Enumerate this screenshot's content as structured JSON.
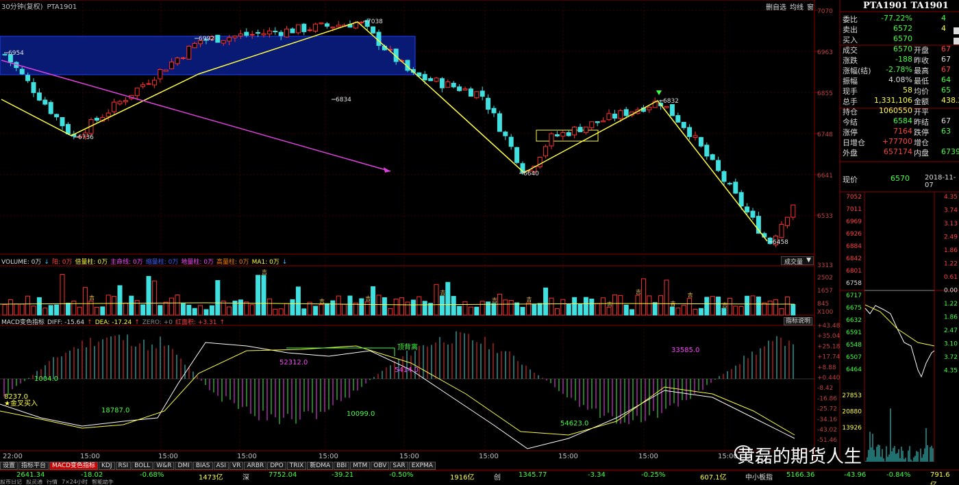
{
  "topbar": {
    "period": "30分钟(复权)",
    "symbol": "PTA1901"
  },
  "topright": {
    "btn1": "删自选",
    "btn2": "均线",
    "btn3": "窗"
  },
  "price_axis": [
    "7070",
    "6963",
    "6855",
    "6748",
    "6641",
    "6533"
  ],
  "annotations": {
    "p6954": "6954",
    "p6992": "6992",
    "p7038": "7038",
    "p6736": "6736",
    "p6834": "6834",
    "p6640": "6640",
    "p6832": "6832",
    "p6458": "6458"
  },
  "volume": {
    "legend": [
      {
        "t": "VOLUME: 0万",
        "c": "#ddd"
      },
      {
        "t": "↓",
        "c": "#30c0ff"
      },
      {
        "t": "阳: 0万",
        "c": "#ff4040"
      },
      {
        "t": "倍量柱: 0万",
        "c": "#ffff40"
      },
      {
        "t": "主命线: 0万",
        "c": "#ff40ff"
      },
      {
        "t": "缩量柱: 0万",
        "c": "#4060ff"
      },
      {
        "t": "地量柱: 0万",
        "c": "#ff40ff"
      },
      {
        "t": "高量柱: 0万",
        "c": "#ff8000"
      },
      {
        "t": "MA1: 0万",
        "c": "#ffff40"
      },
      {
        "t": "↓",
        "c": "#30c0ff"
      }
    ],
    "dropdown": "成交量",
    "axis": [
      "3313",
      "2502",
      "1657",
      "845",
      "X100"
    ],
    "tag": "吉"
  },
  "macd": {
    "legend": [
      {
        "t": "MACD变色指标",
        "c": "#ddd"
      },
      {
        "t": "DIFF: -15.64",
        "c": "#ddd"
      },
      {
        "t": "↑",
        "c": "#ff4040"
      },
      {
        "t": "DEA: -17.24",
        "c": "#ffff40"
      },
      {
        "t": "↑",
        "c": "#ff4040"
      },
      {
        "t": "ZERO: +0",
        "c": "#888"
      },
      {
        "t": "红面积: +3.31",
        "c": "#ff4040"
      },
      {
        "t": "↑",
        "c": "#ff4040"
      }
    ],
    "btn": "指标说明",
    "axis": [
      "+43.48",
      "+35.04",
      "+25.18",
      "+17.74",
      "+8.88",
      "+0.440",
      "-8.42",
      "-16.86",
      "-25.72",
      "-34.16",
      "-43.02",
      "-51.46"
    ],
    "labels": {
      "a1004": "1004.0",
      "a8237": "8237.0",
      "a18787": "18787.0",
      "a52312": "52312.0",
      "a5414": "5414.0",
      "a10099": "10099.0",
      "a54623": "54623.0",
      "a33585": "33585.0"
    },
    "top_div": "顶背离",
    "golden": "★金叉买入"
  },
  "x_axis": [
    "22:00",
    "15:00",
    "15:00",
    "15:00",
    "15:00",
    "15:00",
    "15:00",
    "15:00",
    "15:00",
    "15:00"
  ],
  "tabs": [
    "设置",
    "指标平台",
    "MACD变色指标",
    "KDJ",
    "RSI",
    "BOLL",
    "W&R",
    "DMI",
    "BIAS",
    "ASI",
    "VR",
    "ARBR",
    "DPO",
    "TRIX",
    "新DMA",
    "BBI",
    "MTM",
    "OBV",
    "SAR",
    "EXPMA"
  ],
  "index_bar": {
    "v1": "2641.34",
    "v2": "-18.02",
    "v3": "-0.68%",
    "v4": "1473亿",
    "sz": "深",
    "v5": "7752.04",
    "v6": "-39.21",
    "v7": "-0.50%",
    "v8": "1916亿",
    "cy": "创",
    "v9": "1345.77",
    "v10": "-3.34",
    "v11": "-0.25%",
    "v12": "607.1亿",
    "zx": "中小板指",
    "v13": "5166.36",
    "v14": "-43.96",
    "v15": "-0.84%",
    "v16": "791.6亿"
  },
  "bottombar": [
    "股市日记",
    "股灵通",
    "行情",
    "7×24小时",
    "智能助手"
  ],
  "quote": {
    "title": "PTA1901 TA1901",
    "rows": [
      {
        "l": "委比",
        "v": "-77.22%",
        "vc": "#40ff40",
        "r": "",
        "rv": "4",
        "rc": "#40ff40"
      },
      {
        "l": "卖出",
        "v": "6572",
        "vc": "#40ff40",
        "r": "",
        "rv": "4",
        "rc": "#ffff40"
      },
      {
        "l": "买入",
        "v": "6570",
        "vc": "#40ff40",
        "r": "",
        "rv": "",
        "rc": "#ffff40"
      },
      {
        "l": "成交",
        "v": "6570",
        "vc": "#40ff40",
        "r": "开盘",
        "rv": "67",
        "rc": "#ff4040"
      },
      {
        "l": "涨跌",
        "v": "-188",
        "vc": "#40ff40",
        "r": "昨收",
        "rv": "67",
        "rc": "#ddd"
      },
      {
        "l": "涨幅(结)",
        "v": "-2.78%",
        "vc": "#40ff40",
        "r": "最高",
        "rv": "67",
        "rc": "#ff4040"
      },
      {
        "l": "振幅",
        "v": "4.08%",
        "vc": "#ddd",
        "r": "最低",
        "rv": "64",
        "rc": "#40ff40"
      },
      {
        "l": "现手",
        "v": "58",
        "vc": "#ffff40",
        "r": "均价",
        "rv": "65",
        "rc": "#40ff40"
      },
      {
        "l": "总手",
        "v": "1,331,106",
        "vc": "#ffff40",
        "r": "金额",
        "rv": "438.2",
        "rc": "#ffff40"
      },
      {
        "l": "持仓",
        "v": "1060550",
        "vc": "#ffff40",
        "r": "开平",
        "rv": "",
        "rc": "#ddd"
      },
      {
        "l": "今结",
        "v": "6584",
        "vc": "#40ff40",
        "r": "昨结",
        "rv": "67",
        "rc": "#ddd"
      },
      {
        "l": "涨停",
        "v": "7164",
        "vc": "#ff4040",
        "r": "跌停",
        "rv": "63",
        "rc": "#40ff40"
      },
      {
        "l": "日增仓",
        "v": "+77700",
        "vc": "#ff4040",
        "r": "增仓",
        "rv": "",
        "rc": "#ddd"
      },
      {
        "l": "外盘",
        "v": "657174",
        "vc": "#ff4040",
        "r": "内盘",
        "rv": "6739",
        "rc": "#40ff40"
      }
    ],
    "now_label": "现价",
    "now": "6570",
    "date": "2018-11-07"
  },
  "mini": {
    "left_axis": [
      "7052",
      "7011",
      "6969",
      "6926",
      "6884",
      "6842",
      "6801",
      "6758",
      "6717",
      "6675",
      "6632",
      "6591",
      "6548",
      "6507",
      "6464",
      "27853",
      "20880",
      "13926"
    ],
    "right_axis": [
      "4.35",
      "3.74",
      "3.13",
      "2.49",
      "1.86",
      "1.22",
      "0.61",
      "0.00",
      "1.22",
      "1.86",
      "2.47",
      "3.10",
      "3.72",
      "4.35"
    ]
  },
  "watermark": "黄磊的期货人生",
  "colors": {
    "up": "#ff4040",
    "down": "#40e0e0",
    "ma": "#ffff40",
    "frame": "#8b0000"
  },
  "chart_data": {
    "type": "candlestick",
    "values": []
  }
}
